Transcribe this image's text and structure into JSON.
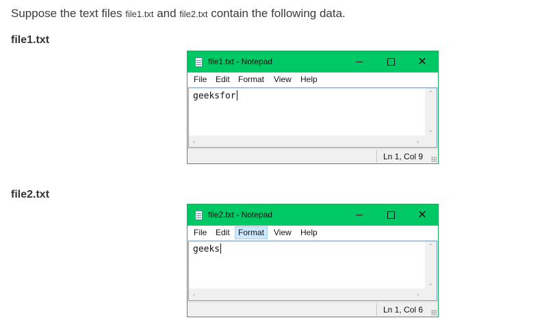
{
  "intro": {
    "part1": "Suppose the text files ",
    "file1": "file1.txt",
    "part2": " and ",
    "file2": "file2.txt",
    "part3": " contain the following data."
  },
  "headings": {
    "file1": "file1.txt",
    "file2": "file2.txt"
  },
  "windows": [
    {
      "title": "file1.txt - Notepad",
      "menu": [
        "File",
        "Edit",
        "Format",
        "View",
        "Help"
      ],
      "content": "geeksfor",
      "status": "Ln 1, Col 9",
      "highlighted_menu": ""
    },
    {
      "title": "file2.txt - Notepad",
      "menu": [
        "File",
        "Edit",
        "Format",
        "View",
        "Help"
      ],
      "content": "geeks",
      "status": "Ln 1, Col 6",
      "highlighted_menu": "Format"
    }
  ],
  "colors": {
    "titlebar": "#00c865",
    "menu_highlight": "#cce8ff"
  },
  "icons": [
    "notepad-icon",
    "minimize-icon",
    "maximize-icon",
    "close-icon",
    "scroll-up-icon",
    "scroll-down-icon",
    "scroll-left-icon",
    "scroll-right-icon",
    "resize-grip-icon"
  ]
}
